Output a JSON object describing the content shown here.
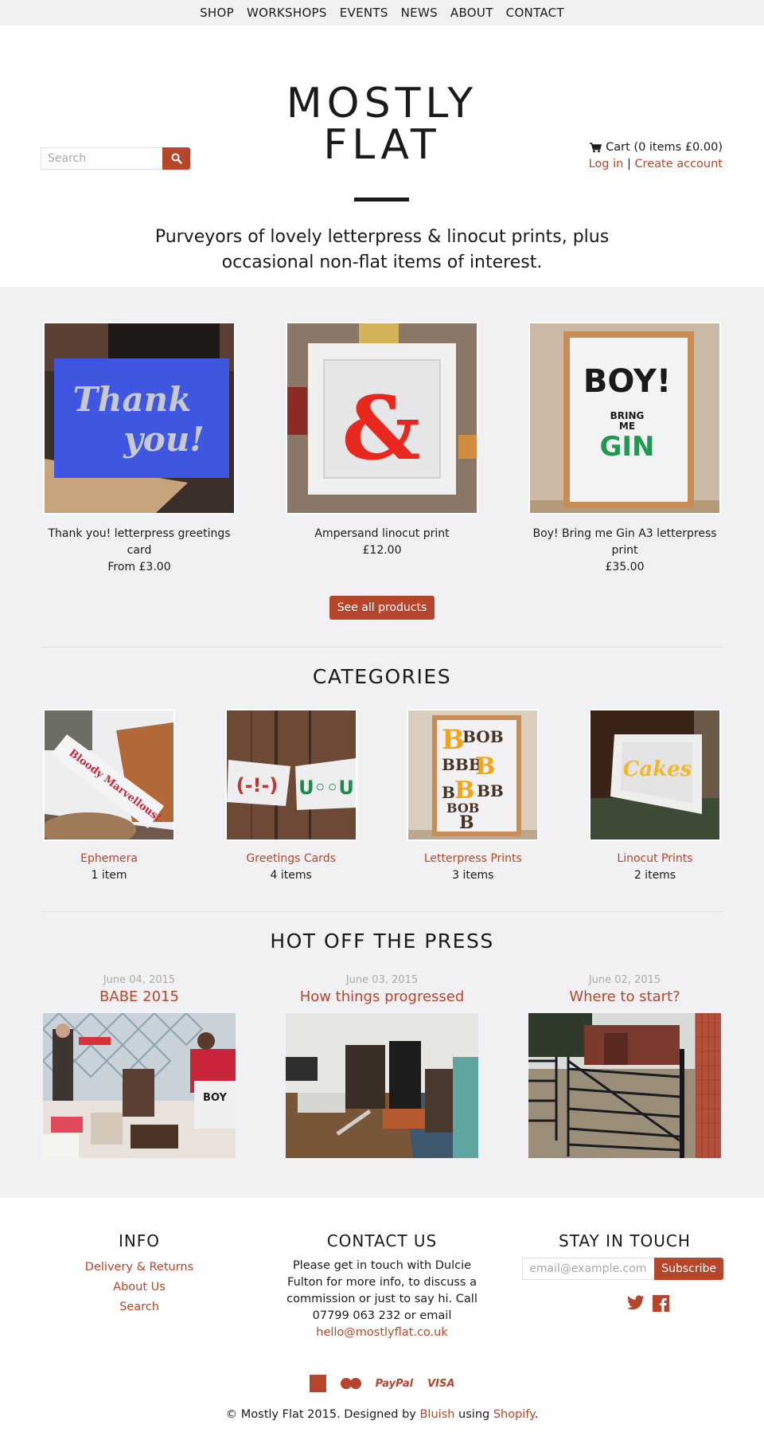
{
  "nav": {
    "items": [
      "SHOP",
      "WORKSHOPS",
      "EVENTS",
      "NEWS",
      "ABOUT",
      "CONTACT"
    ]
  },
  "header": {
    "logo_line1": "MOSTLY",
    "logo_line2": "FLAT",
    "search_placeholder": "Search",
    "search_icon": "search-icon",
    "cart_icon": "cart-icon",
    "cart_label": "Cart (0 items £0.00)",
    "login_label": "Log in",
    "separator": "|",
    "create_account_label": "Create account",
    "tagline": "Purveyors of lovely letterpress & linocut prints, plus occasional non-flat items of interest."
  },
  "products": [
    {
      "title": "Thank you! letterpress greetings card",
      "price": "From £3.00",
      "image": "Blue card with silver 'Thank you!' lettering",
      "image_text_1": "Thank",
      "image_text_2": "you!"
    },
    {
      "title": "Ampersand linocut print",
      "price": "£12.00",
      "image": "Red ampersand print in white frame",
      "image_text_1": "&"
    },
    {
      "title": "Boy! Bring me Gin A3 letterpress print",
      "price": "£35.00",
      "image": "Framed print reading BOY! BRING ME GIN",
      "image_text_1": "BOY!",
      "image_text_2": "BRING",
      "image_text_3": "ME",
      "image_text_4": "GIN"
    }
  ],
  "see_all_label": "See all products",
  "categories_title": "CATEGORIES",
  "categories": [
    {
      "name": "Ephemera",
      "count": "1 item",
      "image_text": "Bloody Marvellous!"
    },
    {
      "name": "Greetings Cards",
      "count": "4 items"
    },
    {
      "name": "Letterpress Prints",
      "count": "3 items",
      "image_text": "B"
    },
    {
      "name": "Linocut Prints",
      "count": "2 items",
      "image_text": "Cakes"
    }
  ],
  "blog_title": "HOT OFF THE PRESS",
  "posts": [
    {
      "date": "June 04, 2015",
      "title": "BABE 2015"
    },
    {
      "date": "June 03, 2015",
      "title": "How things progressed"
    },
    {
      "date": "June 02, 2015",
      "title": "Where to start?"
    }
  ],
  "footer": {
    "info_title": "INFO",
    "info_links": [
      "Delivery & Returns",
      "About Us",
      "Search"
    ],
    "contact_title": "CONTACT US",
    "contact_text": "Please get in touch with Dulcie Fulton for more info, to discuss a commission or just to say hi. Call 07799 063 232 or email ",
    "contact_email": "hello@mostlyflat.co.uk",
    "stay_title": "STAY IN TOUCH",
    "email_placeholder": "email@example.com",
    "subscribe_label": "Subscribe",
    "social": [
      "twitter-icon",
      "facebook-icon"
    ],
    "payments": [
      "american-express",
      "mastercard",
      "PayPal",
      "VISA"
    ],
    "copyright_prefix": "© Mostly Flat 2015. Designed by ",
    "designer_link": "Bluish",
    "using_text": " using ",
    "platform_link": "Shopify",
    "copyright_suffix": "."
  },
  "colors": {
    "accent": "#b5452b",
    "background_main": "#f1f1f3",
    "text": "#1a1a1a",
    "muted": "#aaaaaa"
  }
}
